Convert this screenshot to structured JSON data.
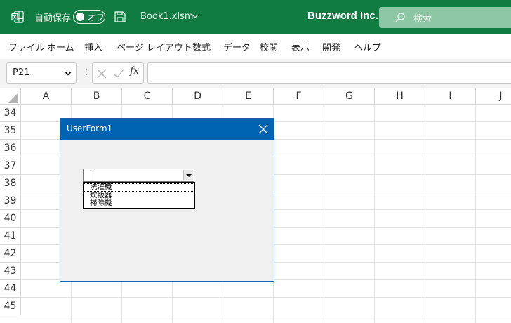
{
  "titlebar": {
    "app_icon": "excel-icon",
    "autosave_label": "自動保存",
    "autosave_state": "オフ",
    "filename": "Book1.xlsm",
    "company": "Buzzword Inc.",
    "search_placeholder": "検索",
    "bg_color": "#107c41"
  },
  "menu": {
    "items": [
      "ファイル",
      "ホーム",
      "挿入",
      "ページ レイアウト",
      "数式",
      "データ",
      "校閲",
      "表示",
      "開発",
      "ヘルプ"
    ]
  },
  "formula_bar": {
    "name_box": "P21",
    "fx_label": "fx",
    "formula": ""
  },
  "grid": {
    "columns": [
      "A",
      "B",
      "C",
      "D",
      "E",
      "F",
      "G",
      "H",
      "I",
      "J"
    ],
    "rows": [
      "34",
      "35",
      "36",
      "37",
      "38",
      "39",
      "40",
      "41",
      "42",
      "43",
      "44",
      "45"
    ]
  },
  "userform": {
    "title": "UserForm1",
    "combobox_value": "",
    "list_items": [
      "洗濯機",
      "炊飯器",
      "掃除機"
    ],
    "title_color": "#0063b1"
  }
}
